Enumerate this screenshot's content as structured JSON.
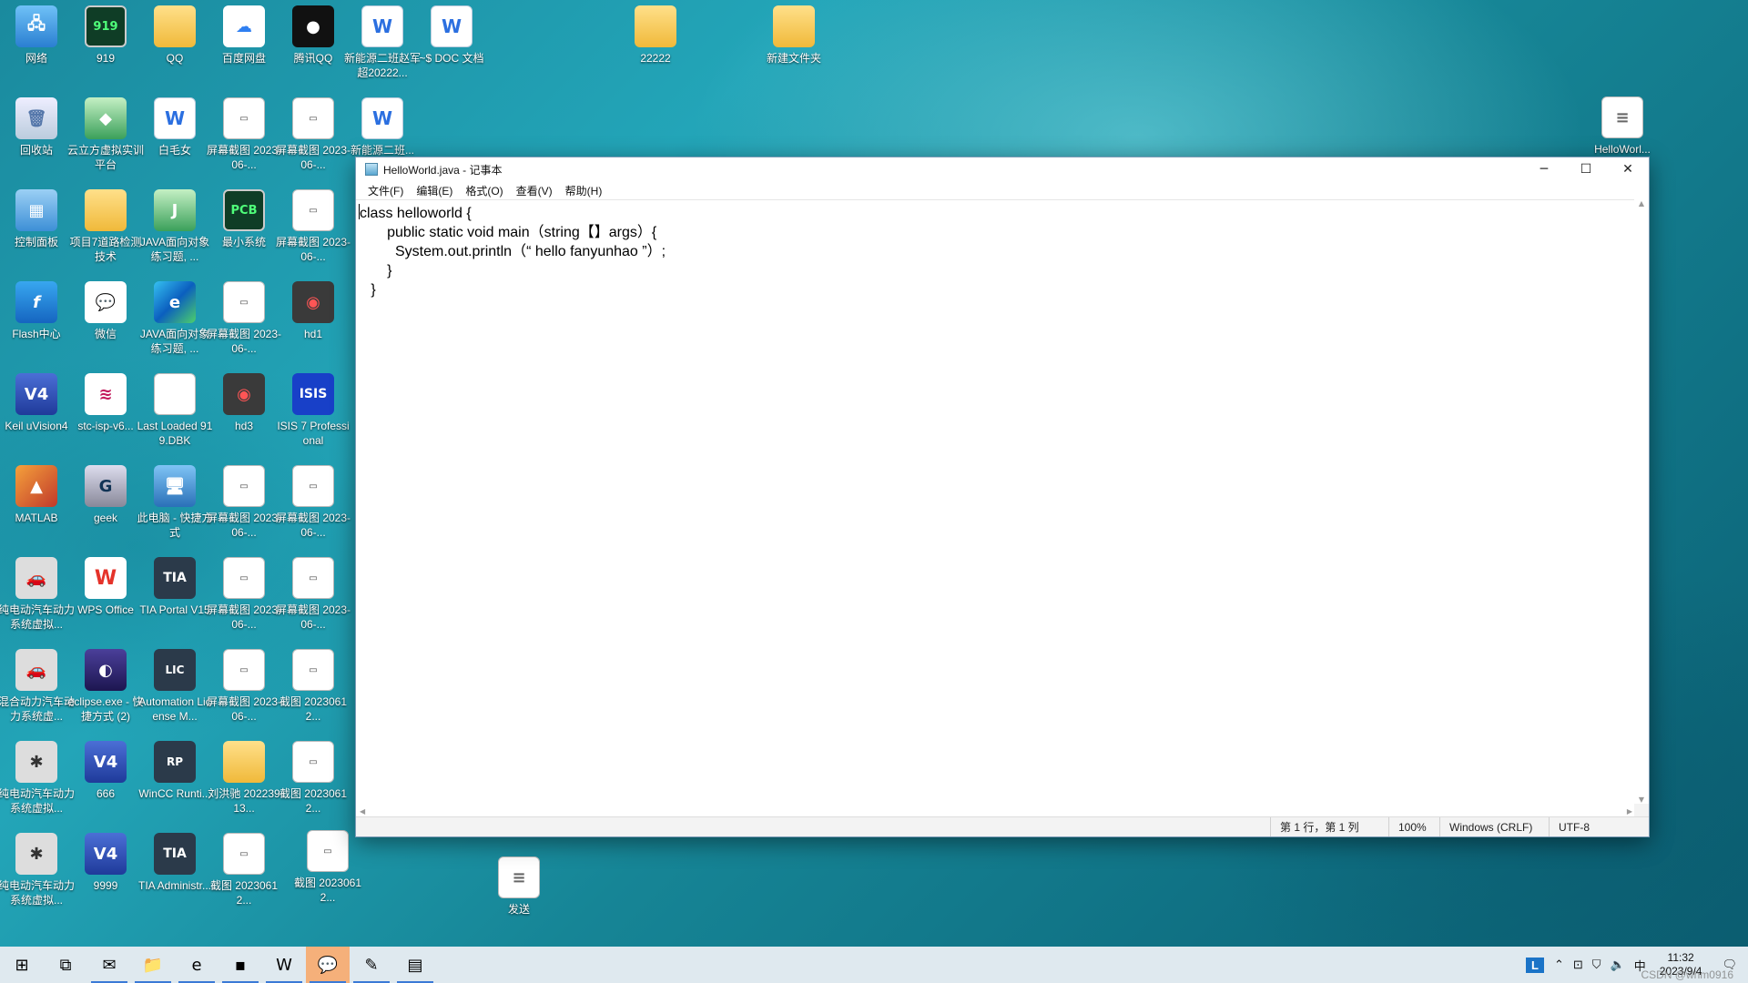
{
  "desktop_icons": [
    {
      "label": "网络",
      "icon": "network-icon",
      "glyph": "🖧",
      "cls": "g-net"
    },
    {
      "label": "919",
      "icon": "pcb-app-icon",
      "glyph": "919",
      "cls": "g-green"
    },
    {
      "label": "QQ",
      "icon": "folder-icon",
      "glyph": "",
      "cls": "g-folder"
    },
    {
      "label": "百度网盘",
      "icon": "baidu-netdisk-icon",
      "glyph": "☁",
      "cls": "g-baidu"
    },
    {
      "label": "腾讯QQ",
      "icon": "qq-penguin-icon",
      "glyph": "●",
      "cls": "g-qq"
    },
    {
      "label": "新能源二班赵军超20222...",
      "icon": "word-doc-icon",
      "glyph": "W",
      "cls": "g-word"
    },
    {
      "label": "~$ DOC 文档",
      "icon": "word-doc-icon",
      "glyph": "W",
      "cls": "g-word"
    },
    {
      "label": "22222",
      "icon": "folder-icon",
      "glyph": "",
      "cls": "g-folder"
    },
    {
      "label": "新建文件夹",
      "icon": "folder-icon",
      "glyph": "",
      "cls": "g-folder"
    },
    {
      "label": "回收站",
      "icon": "recycle-bin-icon",
      "glyph": "🗑",
      "cls": "g-bin"
    },
    {
      "label": "云立方虚拟实训平台",
      "icon": "cube-app-icon",
      "glyph": "◆",
      "cls": "g-java"
    },
    {
      "label": "白毛女",
      "icon": "word-doc-icon",
      "glyph": "W",
      "cls": "g-word"
    },
    {
      "label": "屏幕截图 2023-06-...",
      "icon": "screenshot-icon",
      "glyph": "▭",
      "cls": "g-shot"
    },
    {
      "label": "屏幕截图 2023-06-...",
      "icon": "screenshot-icon",
      "glyph": "▭",
      "cls": "g-shot"
    },
    {
      "label": "新能源二班...",
      "icon": "word-doc-icon",
      "glyph": "W",
      "cls": "g-word"
    },
    {
      "label": "控制面板",
      "icon": "control-panel-icon",
      "glyph": "▦",
      "cls": "g-panel"
    },
    {
      "label": "项目7道路检测技术",
      "icon": "folder-icon",
      "glyph": "",
      "cls": "g-folder"
    },
    {
      "label": "JAVA面向对象练习题, ...",
      "icon": "java-folder-icon",
      "glyph": "J",
      "cls": "g-java"
    },
    {
      "label": "最小系统",
      "icon": "pcb-app-icon",
      "glyph": "PCB",
      "cls": "g-green"
    },
    {
      "label": "屏幕截图 2023-06-...",
      "icon": "screenshot-icon",
      "glyph": "▭",
      "cls": "g-shot"
    },
    {
      "label": "Flash中心",
      "icon": "flash-icon",
      "glyph": "f",
      "cls": "g-flash"
    },
    {
      "label": "微信",
      "icon": "wechat-icon",
      "glyph": "💬",
      "cls": "g-wechat"
    },
    {
      "label": "JAVA面向对象练习题, ...",
      "icon": "edge-icon",
      "glyph": "e",
      "cls": "g-edge"
    },
    {
      "label": "屏幕截图 2023-06-...",
      "icon": "screenshot-icon",
      "glyph": "▭",
      "cls": "g-shot"
    },
    {
      "label": "hd1",
      "icon": "camera-icon",
      "glyph": "◉",
      "cls": "g-cam"
    },
    {
      "label": "Keil uVision4",
      "icon": "keil-icon",
      "glyph": "V4",
      "cls": "g-keil"
    },
    {
      "label": "stc-isp-v6...",
      "icon": "stc-isp-icon",
      "glyph": "≋",
      "cls": "g-stc"
    },
    {
      "label": "Last Loaded 919.DBK",
      "icon": "blank-file-icon",
      "glyph": "",
      "cls": "g-file"
    },
    {
      "label": "hd3",
      "icon": "camera-icon",
      "glyph": "◉",
      "cls": "g-cam"
    },
    {
      "label": "ISIS 7 Professional",
      "icon": "isis-icon",
      "glyph": "ISIS",
      "cls": "g-isis"
    },
    {
      "label": "MATLAB",
      "icon": "matlab-icon",
      "glyph": "▲",
      "cls": "g-matlab"
    },
    {
      "label": "geek",
      "icon": "geek-icon",
      "glyph": "G",
      "cls": "g-geek"
    },
    {
      "label": "此电脑 - 快捷方式",
      "icon": "this-pc-icon",
      "glyph": "🖥",
      "cls": "g-pc"
    },
    {
      "label": "屏幕截图 2023-06-...",
      "icon": "screenshot-icon",
      "glyph": "▭",
      "cls": "g-shot"
    },
    {
      "label": "屏幕截图 2023-06-...",
      "icon": "screenshot-icon",
      "glyph": "▭",
      "cls": "g-shot"
    },
    {
      "label": "纯电动汽车动力系统虚拟...",
      "icon": "car-sim-icon",
      "glyph": "🚗",
      "cls": "g-car"
    },
    {
      "label": "WPS Office",
      "icon": "wps-icon",
      "glyph": "W",
      "cls": "g-wps"
    },
    {
      "label": "TIA Portal V15",
      "icon": "tia-portal-icon",
      "glyph": "TIA",
      "cls": "g-tia"
    },
    {
      "label": "屏幕截图 2023-06-...",
      "icon": "screenshot-icon",
      "glyph": "▭",
      "cls": "g-shot"
    },
    {
      "label": "屏幕截图 2023-06-...",
      "icon": "screenshot-icon",
      "glyph": "▭",
      "cls": "g-shot"
    },
    {
      "label": "混合动力汽车动力系统虚...",
      "icon": "car-sim-icon",
      "glyph": "🚗",
      "cls": "g-car"
    },
    {
      "label": "eclipse.exe - 快捷方式 (2)",
      "icon": "eclipse-icon",
      "glyph": "◐",
      "cls": "g-eclipse"
    },
    {
      "label": "Automation License M...",
      "icon": "license-manager-icon",
      "glyph": "LIC",
      "cls": "g-lic"
    },
    {
      "label": "屏幕截图 2023-06-...",
      "icon": "screenshot-icon",
      "glyph": "▭",
      "cls": "g-shot"
    },
    {
      "label": "截图 20230612...",
      "icon": "screenshot-icon",
      "glyph": "▭",
      "cls": "g-shot"
    },
    {
      "label": "纯电动汽车动力系统虚拟...",
      "icon": "car-chassis-icon",
      "glyph": "✱",
      "cls": "g-car"
    },
    {
      "label": "666",
      "icon": "keil-icon",
      "glyph": "V4",
      "cls": "g-keil"
    },
    {
      "label": "WinCC Runti...",
      "icon": "wincc-icon",
      "glyph": "RP",
      "cls": "g-wincc"
    },
    {
      "label": "刘洪驰 20223913...",
      "icon": "folder-icon",
      "glyph": "",
      "cls": "g-folder"
    },
    {
      "label": "截图 20230612...",
      "icon": "screenshot-icon",
      "glyph": "▭",
      "cls": "g-shot"
    },
    {
      "label": "纯电动汽车动力系统虚拟...",
      "icon": "car-chassis-icon",
      "glyph": "✱",
      "cls": "g-car"
    },
    {
      "label": "9999",
      "icon": "keil-icon",
      "glyph": "V4",
      "cls": "g-keil"
    },
    {
      "label": "TIA Administr...",
      "icon": "tia-admin-icon",
      "glyph": "TIA",
      "cls": "g-tia"
    },
    {
      "label": "截图 20230612...",
      "icon": "screenshot-icon",
      "glyph": "▭",
      "cls": "g-shot"
    },
    {
      "label": "截图 20230612...",
      "icon": "screenshot-icon",
      "glyph": "▭",
      "cls": "g-shot"
    },
    {
      "label": "发送",
      "icon": "text-file-icon",
      "glyph": "≡",
      "cls": "g-doc"
    },
    {
      "label": "HelloWorl...",
      "icon": "text-file-icon",
      "glyph": "≡",
      "cls": "g-doc"
    }
  ],
  "notepad": {
    "title": "HelloWorld.java - 记事本",
    "menu": [
      "文件(F)",
      "编辑(E)",
      "格式(O)",
      "查看(V)",
      "帮助(H)"
    ],
    "content": "class helloworld {\n       public static void main（string【】args）{\n         System.out.println（“ hello fanyunhao ”）;\n       }\n   }",
    "status": {
      "position": "第 1 行，第 1 列",
      "zoom": "100%",
      "line_ending": "Windows (CRLF)",
      "encoding": "UTF-8"
    }
  },
  "taskbar": {
    "items": [
      {
        "name": "start-button",
        "glyph": "⊞"
      },
      {
        "name": "task-view-button",
        "glyph": "⧉"
      },
      {
        "name": "mail-app",
        "glyph": "✉"
      },
      {
        "name": "file-explorer-app",
        "glyph": "📁"
      },
      {
        "name": "edge-app",
        "glyph": "e"
      },
      {
        "name": "terminal-app",
        "glyph": "▪"
      },
      {
        "name": "wps-app",
        "glyph": "W"
      },
      {
        "name": "wechat-app",
        "glyph": "💬"
      },
      {
        "name": "notepad-app-alt",
        "glyph": "✎"
      },
      {
        "name": "notepad-app",
        "glyph": "▤"
      }
    ],
    "tray": {
      "ime_badge": "L",
      "language": "中",
      "time": "11:32",
      "date": "2023/9/4"
    }
  },
  "watermark": "CSDN @whm0916"
}
